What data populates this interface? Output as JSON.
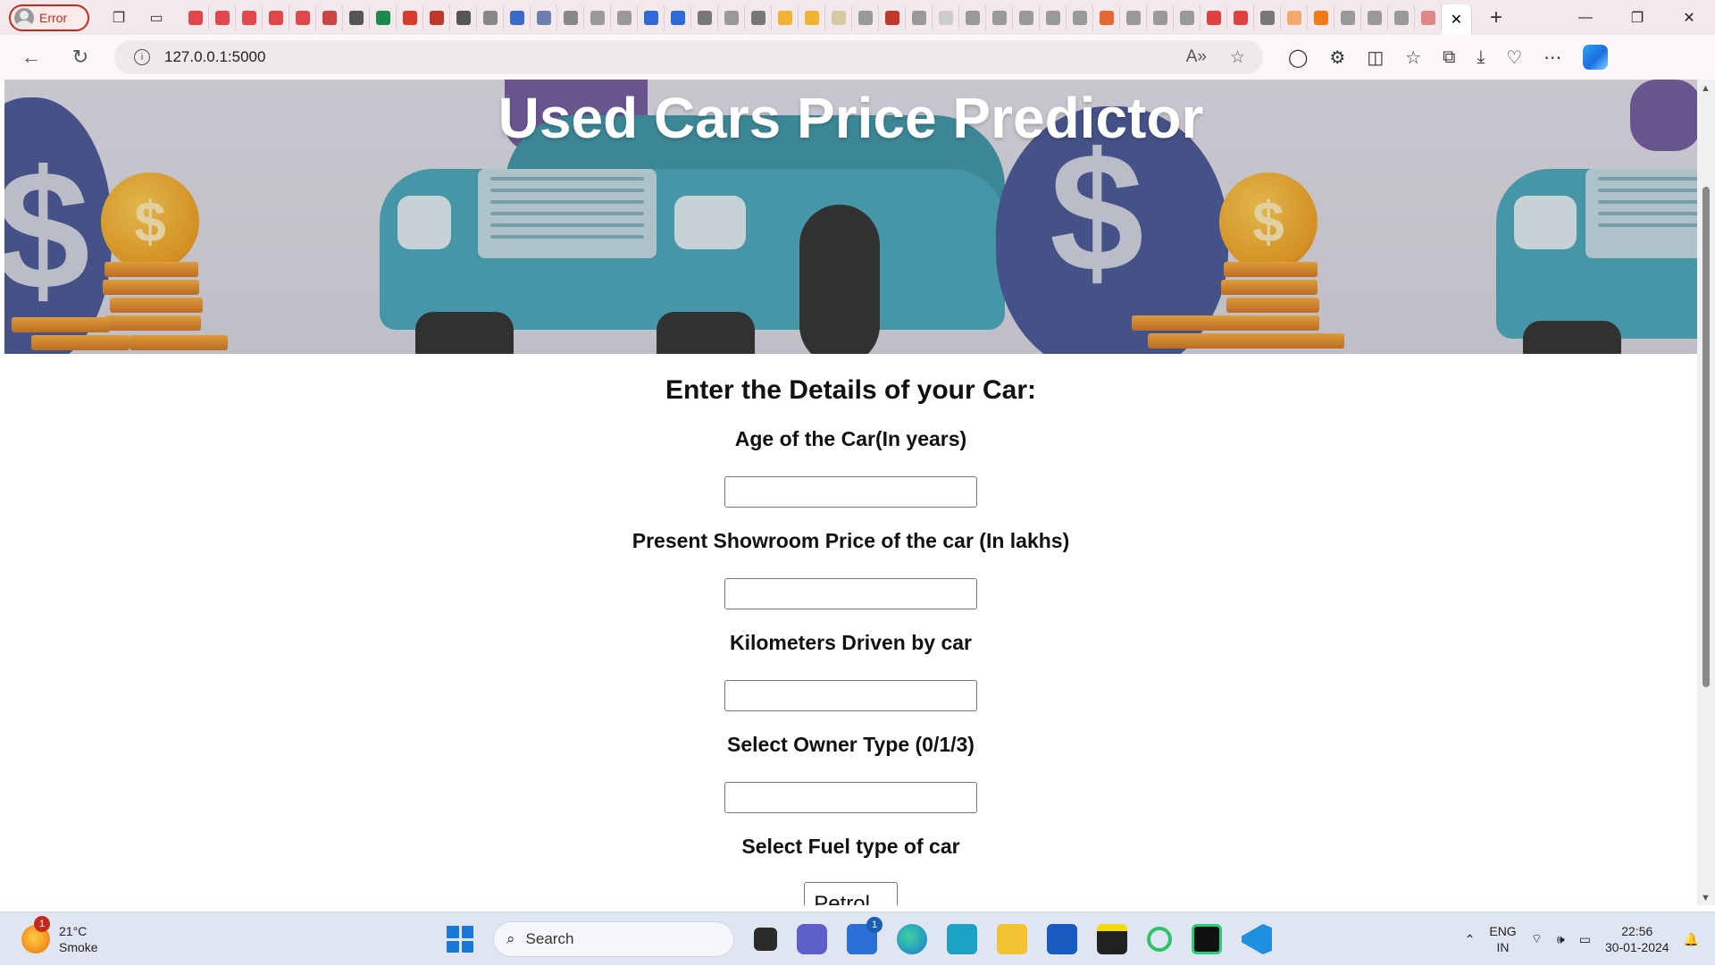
{
  "browser": {
    "profile_label": "Error",
    "url": "127.0.0.1:5000",
    "tab_favicon_colors": [
      "#e0484c",
      "#e0484c",
      "#e0484c",
      "#e0484c",
      "#e0484c",
      "#c44",
      "#555",
      "#1c8a4a",
      "#d93a2e",
      "#c0392b",
      "#555",
      "#888",
      "#3c6ac9",
      "#6a7fb0",
      "#888",
      "#999",
      "#999",
      "#2e6bd9",
      "#2e6bd9",
      "#777",
      "#999",
      "#777",
      "#f2b233",
      "#f2b233",
      "#d8c9a5",
      "#999",
      "#c0392b",
      "#999",
      "#ccc",
      "#999",
      "#999",
      "#999",
      "#999",
      "#999",
      "#e2682f",
      "#999",
      "#999",
      "#999",
      "#e04040",
      "#e04040",
      "#777",
      "#f2a96a",
      "#f07a1a",
      "#999",
      "#999",
      "#999",
      "#d88"
    ]
  },
  "page": {
    "hero_title": "Used Cars Price Predictor",
    "form_heading": "Enter the Details of your Car:",
    "fields": [
      {
        "label": "Age of the Car(In years)",
        "value": ""
      },
      {
        "label": "Present Showroom Price of the car (In lakhs)",
        "value": ""
      },
      {
        "label": "Kilometers Driven by car",
        "value": ""
      },
      {
        "label": "Select Owner Type (0/1/3)",
        "value": ""
      }
    ],
    "fuel_label": "Select Fuel type of car",
    "fuel_selected": "Petrol"
  },
  "taskbar": {
    "weather_badge": "1",
    "temperature": "21°C",
    "condition": "Smoke",
    "search_placeholder": "Search",
    "store_badge": "1",
    "lang_top": "ENG",
    "lang_bottom": "IN",
    "time": "22:56",
    "date": "30-01-2024"
  }
}
